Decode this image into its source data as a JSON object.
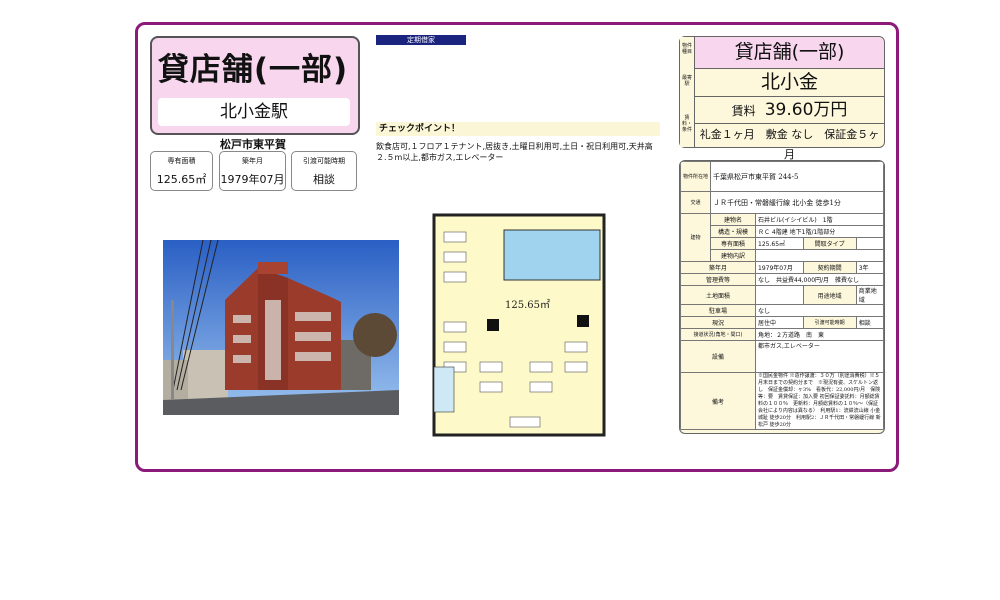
{
  "header": {
    "property_type": "貸店舗(一部)",
    "station": "北小金駅",
    "city": "松戸市東平賀"
  },
  "stats": [
    {
      "label": "専有面積",
      "value": "125.65㎡"
    },
    {
      "label": "築年月",
      "value": "1979年07月"
    },
    {
      "label": "引渡可能時期",
      "value": "相談"
    }
  ],
  "lease_tag": "定期借家",
  "checkpoints": {
    "heading": "チェックポイント！",
    "text": "飲食店可,１フロア１テナント,居抜き,土曜日利用可,土日・祝日利用可,天井高２.５m以上,都市ガス,エレベーター"
  },
  "floorplan": {
    "area_label": "125.65㎡"
  },
  "right_top": {
    "side_label_1": "物件種目",
    "side_label_2": "最寄駅",
    "side_label_3": "賃料・条件",
    "type": "貸店舗(一部)",
    "station": "北小金",
    "rent_label": "賃料",
    "rent": "39.60万円",
    "terms": "礼金１ヶ月　敷金 なし　保証金５ヶ月"
  },
  "details": {
    "address_label": "物件所在地",
    "address": "千葉県松戸市東平賀 244-5",
    "traffic_label": "交通",
    "traffic": "ＪＲ千代田・常磐緩行線 北小金 徒歩1分",
    "building_label": "建物",
    "rows_building": [
      {
        "label": "建物名",
        "value": "石井ビル(イシイビル)　1階"
      },
      {
        "label": "構造・規模",
        "value": "ＲＣ 4階建 地下1階/1階部分"
      },
      {
        "label": "専有面積",
        "value": "125.65㎡",
        "label2": "間取タイプ",
        "value2": ""
      },
      {
        "label": "建物内訳",
        "value": ""
      }
    ],
    "rows_other": [
      {
        "label": "築年月",
        "value": "1979年07月",
        "label2": "契約期間",
        "value2": "3年"
      },
      {
        "label": "管理費等",
        "value": "なし　共益費44,000円/月　雑費なし"
      },
      {
        "label": "土地面積",
        "value": "",
        "label2": "用途地域",
        "value2": "商業地域"
      },
      {
        "label": "駐車場",
        "value": "なし"
      },
      {
        "label": "現況",
        "value": "居住中",
        "label2": "引渡可能時期",
        "value2": "相談"
      },
      {
        "label": "接道状況(角地・間口)",
        "value": "角地：２方道路　南　東"
      },
      {
        "label": "設備",
        "value": "都市ガス,エレベーター"
      }
    ],
    "remarks_label": "備考",
    "remarks": "※国民金物件 ※造作譲渡：３０万（別途消費税）※５月末日までの契約分まで　※現況有姿、スケルトン返し　保証金償却：ヶ3%　看板代：22,000円/月　保険等：要　賃貸保証：加入要 初回保証委託料：月額総賃料の１００％　更新料：月額総賃料の１０％～（保証会社により内容は異なる）　利用駅1：流鉄流山線 小金城趾 徒歩20分　利用駅2：ＪＲ千代田・常磐緩行線 新松戸 徒歩20分"
  },
  "colors": {
    "frame": "#8b1a7a",
    "pink": "#f7d6ee",
    "cream": "#fdf8dc",
    "navy": "#1a237e"
  }
}
